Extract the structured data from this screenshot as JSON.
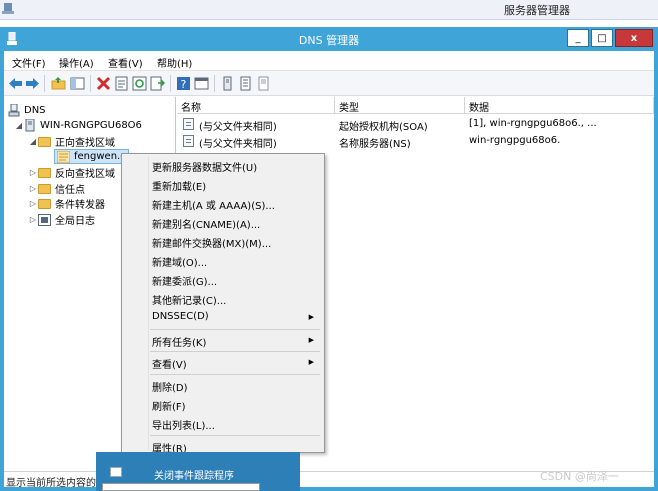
{
  "background_window": {
    "title": "服务器管理器"
  },
  "window": {
    "title": "DNS 管理器",
    "controls": {
      "minimize": "_",
      "maximize": "□",
      "close": "x"
    }
  },
  "menubar": {
    "items": [
      "文件(F)",
      "操作(A)",
      "查看(V)",
      "帮助(H)"
    ]
  },
  "toolbar": {
    "icons": [
      "back-icon",
      "forward-icon",
      "up-folder-icon",
      "show-hide-tree-icon",
      "delete-icon",
      "properties-icon",
      "refresh-icon",
      "export-list-icon",
      "help-icon",
      "console-icon",
      "server-icon",
      "server-list-icon",
      "server-status-icon"
    ]
  },
  "tree": {
    "root": "DNS",
    "server": "WIN-RGNGPGU68O6",
    "forward_zones": "正向查找区域",
    "zone": "fengwen.c",
    "reverse_zones": "反向查找区域",
    "trust_points": "信任点",
    "conditional_forwarders": "条件转发器",
    "global_logs": "全局日志"
  },
  "list": {
    "columns": [
      "名称",
      "类型",
      "数据"
    ],
    "rows": [
      {
        "name": "(与父文件夹相同)",
        "type": "起始授权机构(SOA)",
        "data": "[1], win-rgngpgu68o6., ..."
      },
      {
        "name": "(与父文件夹相同)",
        "type": "名称服务器(NS)",
        "data": "win-rgngpgu68o6."
      }
    ]
  },
  "context_menu": {
    "items": [
      "更新服务器数据文件(U)",
      "重新加载(E)",
      "新建主机(A 或 AAAA)(S)...",
      "新建别名(CNAME)(A)...",
      "新建邮件交换器(MX)(M)...",
      "新建域(O)...",
      "新建委派(G)...",
      "其他新记录(C)...",
      "DNSSEC(D)",
      "所有任务(K)",
      "查看(V)",
      "删除(D)",
      "刷新(F)",
      "导出列表(L)...",
      "属性(R)"
    ],
    "submenu_arrow": "▶"
  },
  "statusbar": {
    "text": "显示当前所选内容的"
  },
  "taskbar_popup": {
    "text": "关闭事件跟踪程序"
  },
  "watermark": "CSDN @尚泽一",
  "colors": {
    "title_bar": "#3fa5d9",
    "close_button": "#c7383a",
    "selection": "#cce4f7",
    "popup": "#2d7fb8"
  }
}
